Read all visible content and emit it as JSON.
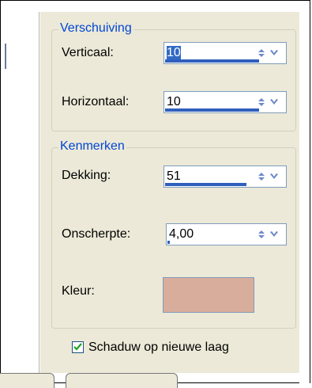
{
  "offset_group": {
    "title": "Verschuiving",
    "vertical": {
      "label": "Verticaal:",
      "value": "10",
      "level": 0.78
    },
    "horizontal": {
      "label": "Horizontaal:",
      "value": "10",
      "level": 0.78
    }
  },
  "properties_group": {
    "title": "Kenmerken",
    "opacity": {
      "label": "Dekking:",
      "value": "51",
      "level": 0.68
    },
    "blur": {
      "label": "Onscherpte:",
      "value": "4,00",
      "level": 0.02
    },
    "color": {
      "label": "Kleur:",
      "value": "#d9ad9c"
    }
  },
  "new_layer_checkbox": {
    "label": "Schaduw op nieuwe laag",
    "checked": true
  },
  "colors": {
    "accent": "#0046d5",
    "panel": "#ece9d8",
    "bar": "#2f5fbd"
  }
}
